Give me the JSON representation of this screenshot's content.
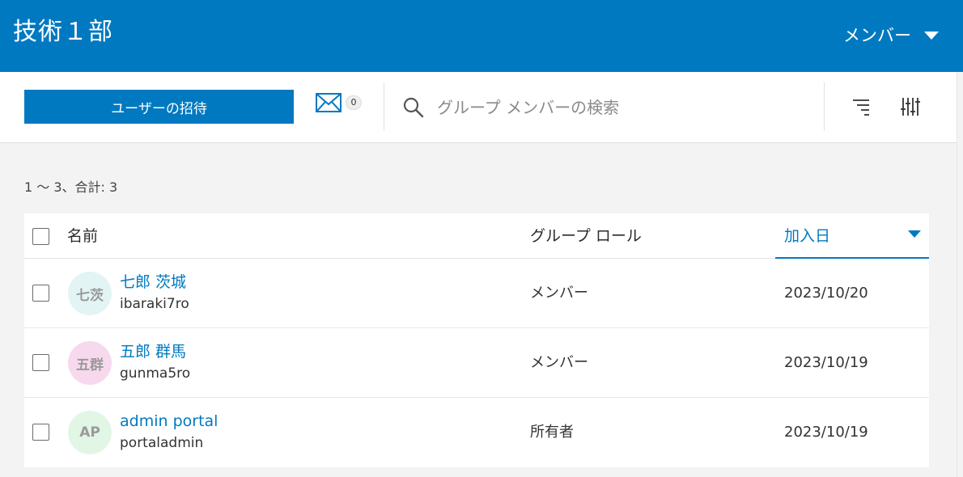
{
  "header": {
    "title": "技術１部",
    "role_menu_label": "メンバー"
  },
  "toolbar": {
    "invite_label": "ユーザーの招待",
    "invitation_count": "0",
    "search_placeholder": "グループ メンバーの検索"
  },
  "summary": {
    "count_text": "1 〜 3、合計: 3"
  },
  "table": {
    "columns": {
      "name": "名前",
      "role": "グループ ロール",
      "joined": "加入日"
    },
    "rows": [
      {
        "initials": "七茨",
        "avatar_color": "#e3f4f4",
        "full_name": "七郎 茨城",
        "username": "ibaraki7ro",
        "role": "メンバー",
        "joined": "2023/10/20"
      },
      {
        "initials": "五群",
        "avatar_color": "#f7d9ee",
        "full_name": "五郎 群馬",
        "username": "gunma5ro",
        "role": "メンバー",
        "joined": "2023/10/19"
      },
      {
        "initials": "AP",
        "avatar_color": "#e2f6e6",
        "full_name": "admin portal",
        "username": "portaladmin",
        "role": "所有者",
        "joined": "2023/10/19"
      }
    ]
  },
  "colors": {
    "brand": "#0079c1"
  },
  "icons": {
    "mail": "envelope-icon",
    "search": "search-icon",
    "sort": "sort-icon",
    "filter": "filter-sliders-icon",
    "dropdown": "caret-down-icon"
  }
}
